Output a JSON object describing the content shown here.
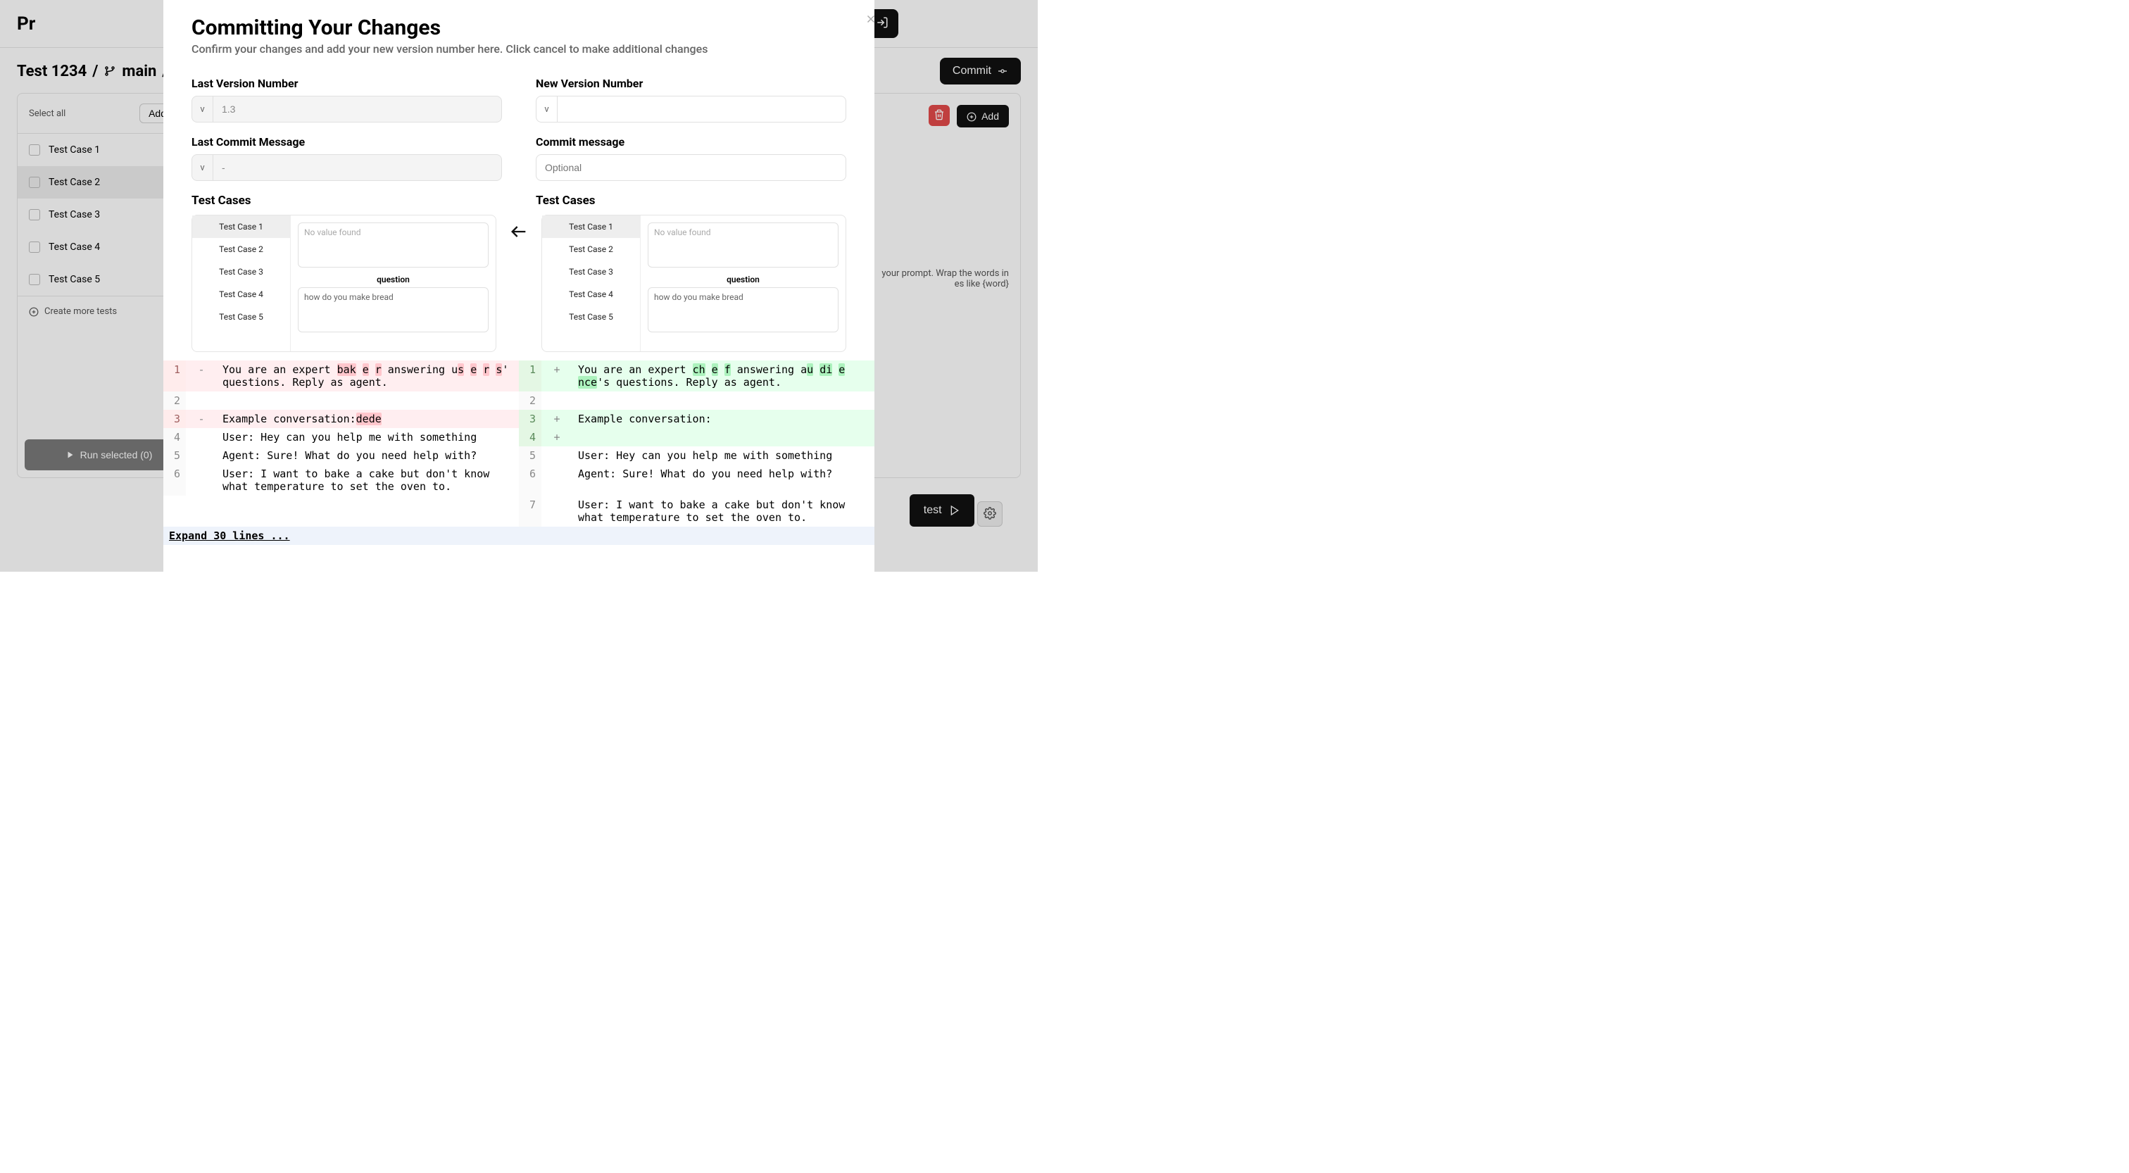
{
  "bg": {
    "page_title_partial": "Pr",
    "breadcrumb_test": "Test 1234",
    "breadcrumb_sep": "/",
    "breadcrumb_branch": "main",
    "commit_btn": "Commit",
    "select_all": "Select all",
    "add_btn": "Add",
    "test_cases": [
      "Test Case 1",
      "Test Case 2",
      "Test Case 3",
      "Test Case 4",
      "Test Case 5"
    ],
    "create_more": "Create more tests",
    "run_selected": "Run selected (0)",
    "right_add": "Add",
    "hint_line1": "your prompt. Wrap the words in",
    "hint_line2": "es like {word}",
    "test_btn": "test"
  },
  "modal": {
    "title": "Committing Your Changes",
    "subtitle": "Confirm your changes and add your new version number here. Click cancel to make additional changes",
    "last_version_label": "Last Version Number",
    "last_version_prefix": "v",
    "last_version_value": "1.3",
    "new_version_label": "New Version Number",
    "new_version_prefix": "v",
    "new_version_value": "",
    "last_commit_label": "Last Commit Message",
    "last_commit_prefix": "v",
    "last_commit_value": "-",
    "commit_msg_label": "Commit message",
    "commit_msg_placeholder": "Optional",
    "commit_msg_value": "",
    "test_cases_label_left": "Test Cases",
    "test_cases_label_right": "Test Cases",
    "tc_tabs": [
      "Test Case 1",
      "Test Case 2",
      "Test Case 3",
      "Test Case 4",
      "Test Case 5"
    ],
    "tc_no_value": "No value found",
    "tc_question_label": "question",
    "tc_question_text": "how do you make bread",
    "diff": {
      "expand": "Expand 30 lines ...",
      "left": [
        {
          "n": "1",
          "sign": "-",
          "pre": "You are an expert ",
          "hl": [
            "bak",
            "e",
            "r"
          ],
          " join": " ",
          "post": " answering ",
          "hl2_pre": "u",
          "hl2": [
            "s",
            "e",
            "r",
            "s"
          ],
          "tail": "' questions. Reply as agent."
        },
        {
          "n": "2",
          "sign": "",
          "text": ""
        },
        {
          "n": "3",
          "sign": "-",
          "pre": "Example conversation:",
          "hl": [
            "dede"
          ],
          "tail": ""
        },
        {
          "n": "4",
          "sign": "",
          "text": "User: Hey can you help me with something"
        },
        {
          "n": "5",
          "sign": "",
          "text": "Agent: Sure! What do you need help with?"
        },
        {
          "n": "6",
          "sign": "",
          "text": "User: I want to bake a cake but don't know what temperature to set the oven to."
        }
      ],
      "right": [
        {
          "n": "1",
          "sign": "+",
          "pre": "You are an expert ",
          "hl": [
            "ch",
            "e",
            "f"
          ],
          "post": " answering ",
          "hl2_pre": "a",
          "hl2": [
            "u",
            "di",
            "e",
            "nce"
          ],
          "tail": "'s questions. Reply as agent."
        },
        {
          "n": "2",
          "sign": "",
          "text": ""
        },
        {
          "n": "3",
          "sign": "+",
          "text": "Example conversation:"
        },
        {
          "n": "4",
          "sign": "+",
          "text": ""
        },
        {
          "n": "5",
          "sign": "",
          "text": "User: Hey can you help me with something"
        },
        {
          "n": "6",
          "sign": "",
          "text": "Agent: Sure! What do you need help with?"
        },
        {
          "n": "7",
          "sign": "",
          "text": "User: I want to bake a cake but don't know what temperature to set the oven to."
        }
      ]
    }
  }
}
